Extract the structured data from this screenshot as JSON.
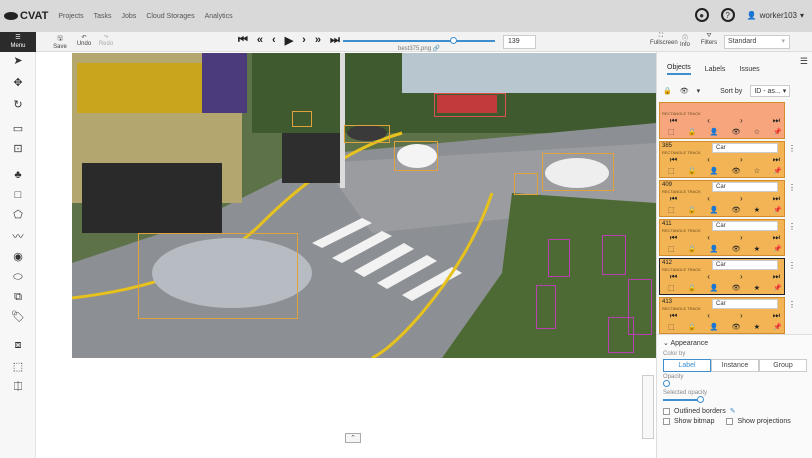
{
  "app": {
    "logo_text": "CVAT"
  },
  "nav": [
    "Projects",
    "Tasks",
    "Jobs",
    "Cloud Storages",
    "Analytics"
  ],
  "user": {
    "name": "worker103"
  },
  "toolbar": {
    "menu_label": "Menu",
    "save_label": "Save",
    "undo_label": "Undo",
    "redo_label": "Redo",
    "filename": "best375.png",
    "frame_number": "139",
    "fullscreen_label": "Fullscreen",
    "info_label": "Info",
    "filters_label": "Filters",
    "workspace": "Standard"
  },
  "sidebar": {
    "tabs": [
      "Objects",
      "Labels",
      "Issues"
    ],
    "sort_label": "Sort by",
    "sort_value": "ID - as...",
    "objects": [
      {
        "id": "",
        "type": "RECTANGLE TRACK",
        "label": "",
        "first": true
      },
      {
        "id": "385",
        "type": "RECTANGLE TRACK",
        "label": "Car"
      },
      {
        "id": "409",
        "type": "RECTANGLE TRACK",
        "label": "Car"
      },
      {
        "id": "411",
        "type": "RECTANGLE TRACK",
        "label": "Car"
      },
      {
        "id": "412",
        "type": "RECTANGLE TRACK",
        "label": "Car",
        "selected": true
      },
      {
        "id": "413",
        "type": "RECTANGLE TRACK",
        "label": "Car"
      }
    ]
  },
  "appearance": {
    "title": "Appearance",
    "color_by_label": "Color by",
    "color_options": [
      "Label",
      "Instance",
      "Group"
    ],
    "opacity_label": "Opacity",
    "selected_opacity_label": "Selected opacity",
    "outlined_borders_label": "Outlined borders",
    "show_bitmap_label": "Show bitmap",
    "show_projections_label": "Show projections"
  }
}
